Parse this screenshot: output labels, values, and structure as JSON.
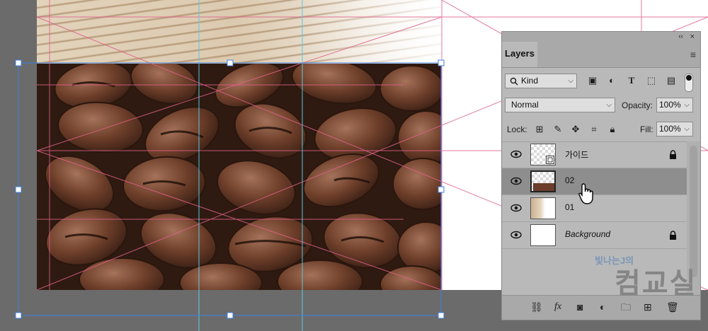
{
  "panel": {
    "collapse_glyph": "‹‹",
    "close_glyph": "×",
    "tab_label": "Layers",
    "menu_icon": "panel-menu-icon",
    "filter": {
      "kind_label": "Kind",
      "icons": [
        "image-filter-icon",
        "adjustment-filter-icon",
        "type-filter-icon",
        "shape-filter-icon",
        "smart-object-filter-icon",
        "filter-toggle-icon"
      ]
    },
    "blend_mode": "Normal",
    "opacity_label": "Opacity:",
    "opacity_value": "100%",
    "lock_label": "Lock:",
    "lock_icons": [
      "lock-transparent-icon",
      "lock-image-icon",
      "lock-position-icon",
      "lock-artboard-icon",
      "lock-all-icon"
    ],
    "fill_label": "Fill:",
    "fill_value": "100%",
    "layers": [
      {
        "name": "가이드",
        "selected": false,
        "locked": true,
        "italic": false,
        "thumb": "smart-object"
      },
      {
        "name": "02",
        "selected": true,
        "locked": false,
        "italic": false,
        "thumb": "coffee"
      },
      {
        "name": "01",
        "selected": false,
        "locked": false,
        "italic": false,
        "thumb": "wood"
      },
      {
        "name": "Background",
        "selected": false,
        "locked": true,
        "italic": true,
        "thumb": "white"
      }
    ],
    "footer_icons": [
      "link-layers-icon",
      "fx-icon",
      "add-mask-icon",
      "new-adjustment-icon",
      "new-group-icon",
      "new-layer-icon",
      "delete-layer-icon"
    ],
    "footer_fx_label": "fx"
  },
  "watermark": {
    "small_text": "빛나는J의",
    "big_text": "컴교실"
  },
  "colors": {
    "guide_pink": "#e0608a",
    "guide_cyan": "#5ec8e0",
    "transform_blue": "#3d7fe0",
    "selected_layer": "#8e8e8e",
    "panel_bg": "#b9b9b9"
  }
}
